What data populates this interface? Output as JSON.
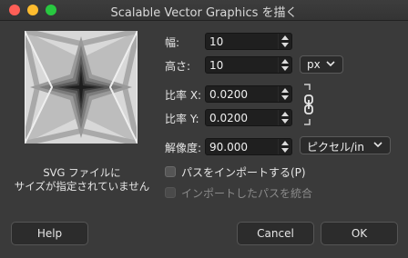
{
  "window": {
    "title": "Scalable Vector Graphics を描く"
  },
  "preview": {
    "caption_line1": "SVG ファイルに",
    "caption_line2": "サイズが指定されていません"
  },
  "fields": {
    "width": {
      "label": "幅:",
      "value": "10"
    },
    "height": {
      "label": "高さ:",
      "value": "10"
    },
    "unit": {
      "value": "px"
    },
    "ratio_x": {
      "label": "比率 X:",
      "value": "0.0200"
    },
    "ratio_y": {
      "label": "比率 Y:",
      "value": "0.0200"
    },
    "resolution": {
      "label": "解像度:",
      "value": "90.000"
    },
    "resolution_unit": {
      "value": "ピクセル/in"
    }
  },
  "options": {
    "import_paths": {
      "label": "パスをインポートする(P)",
      "checked": false
    },
    "merge_paths": {
      "label": "インポートしたパスを統合",
      "checked": false,
      "enabled": false
    }
  },
  "buttons": {
    "help": "Help",
    "cancel": "Cancel",
    "ok": "OK"
  }
}
